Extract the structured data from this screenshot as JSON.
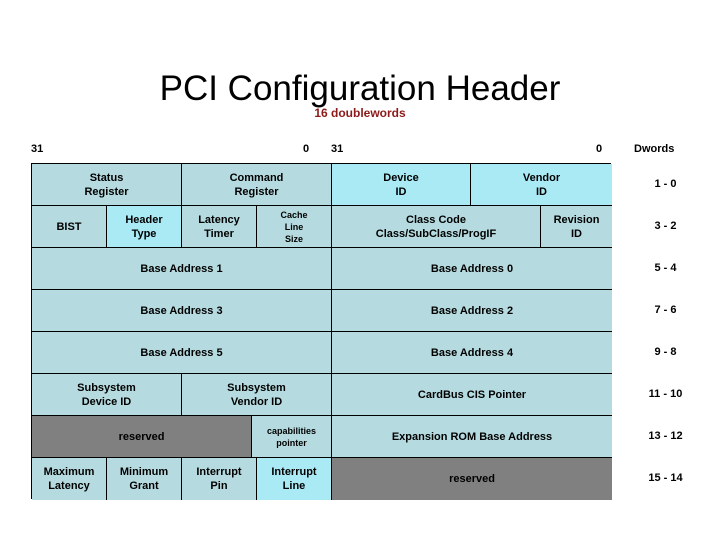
{
  "page": {
    "title": "PCI Configuration Header",
    "subtitle": "16 doublewords",
    "accent_color": "#8c1a1a",
    "cell_color": "#b5dbe0",
    "cell_highlight_color": "#aaeaf5",
    "reserved_color": "#808080"
  },
  "bit_labels": {
    "left_high": "31",
    "left_low": "0",
    "right_high": "31",
    "right_low": "0",
    "dwords_header": "Dwords"
  },
  "dwords": [
    "1 - 0",
    "3 - 2",
    "5 - 4",
    "7 - 6",
    "9 - 8",
    "11 - 10",
    "13 - 12",
    "15 - 14"
  ],
  "rows": [
    {
      "dword": "1 - 0",
      "cells": [
        {
          "label": "Status\nRegister",
          "style": "normal"
        },
        {
          "label": "Command\nRegister",
          "style": "normal"
        },
        {
          "label": "Device\nID",
          "style": "highlight"
        },
        {
          "label": "Vendor\nID",
          "style": "highlight"
        }
      ]
    },
    {
      "dword": "3 - 2",
      "cells": [
        {
          "label": "BIST",
          "style": "normal"
        },
        {
          "label": "Header\nType",
          "style": "highlight"
        },
        {
          "label": "Latency\nTimer",
          "style": "normal"
        },
        {
          "label": "Cache\nLine\nSize",
          "style": "normal"
        },
        {
          "label": "Class Code\nClass/SubClass/ProgIF",
          "style": "normal"
        },
        {
          "label": "Revision\nID",
          "style": "normal"
        }
      ]
    },
    {
      "dword": "5 - 4",
      "cells": [
        {
          "label": "Base Address 1",
          "style": "normal"
        },
        {
          "label": "Base Address 0",
          "style": "normal"
        }
      ]
    },
    {
      "dword": "7 - 6",
      "cells": [
        {
          "label": "Base Address 3",
          "style": "normal"
        },
        {
          "label": "Base Address 2",
          "style": "normal"
        }
      ]
    },
    {
      "dword": "9 - 8",
      "cells": [
        {
          "label": "Base Address 5",
          "style": "normal"
        },
        {
          "label": "Base Address 4",
          "style": "normal"
        }
      ]
    },
    {
      "dword": "11 - 10",
      "cells": [
        {
          "label": "Subsystem\nDevice ID",
          "style": "normal"
        },
        {
          "label": "Subsystem\nVendor ID",
          "style": "normal"
        },
        {
          "label": "CardBus CIS Pointer",
          "style": "normal"
        }
      ]
    },
    {
      "dword": "13 - 12",
      "cells": [
        {
          "label": "reserved",
          "style": "reserved"
        },
        {
          "label": "capabilities\npointer",
          "style": "normal"
        },
        {
          "label": "Expansion ROM Base Address",
          "style": "normal"
        }
      ]
    },
    {
      "dword": "15 - 14",
      "cells": [
        {
          "label": "Maximum\nLatency",
          "style": "normal"
        },
        {
          "label": "Minimum\nGrant",
          "style": "normal"
        },
        {
          "label": "Interrupt\nPin",
          "style": "normal"
        },
        {
          "label": "Interrupt\nLine",
          "style": "highlight"
        },
        {
          "label": "reserved",
          "style": "reserved"
        }
      ]
    }
  ]
}
